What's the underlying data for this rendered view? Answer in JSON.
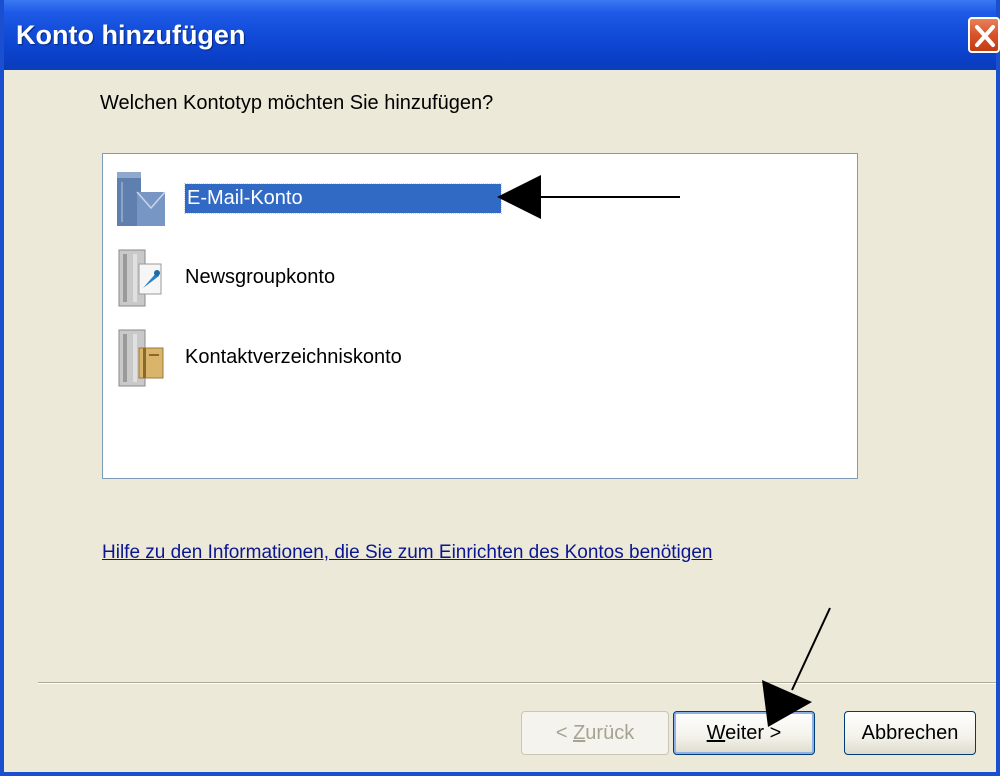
{
  "window": {
    "title": "Konto hinzufügen",
    "close_symbol": "×"
  },
  "main": {
    "question": "Welchen Kontotyp möchten Sie hinzufügen?",
    "account_types": [
      {
        "label": "E-Mail-Konto",
        "icon": "email-server-icon",
        "selected": true
      },
      {
        "label": "Newsgroupkonto",
        "icon": "newsgroup-server-icon",
        "selected": false
      },
      {
        "label": "Kontaktverzeichniskonto",
        "icon": "directory-server-icon",
        "selected": false
      }
    ],
    "help_link": "Hilfe zu den Informationen, die Sie zum Einrichten des Kontos benötigen"
  },
  "footer": {
    "back": {
      "prefix": "< ",
      "mnemonic": "Z",
      "rest": "urück"
    },
    "next": {
      "mnemonic": "W",
      "rest": "eiter",
      "suffix": " >"
    },
    "cancel": "Abbrechen"
  },
  "colors": {
    "titlebar": "#0f49d6",
    "selection": "#316ac5",
    "dialog_bg": "#ece9d8",
    "link": "#0a1690"
  }
}
